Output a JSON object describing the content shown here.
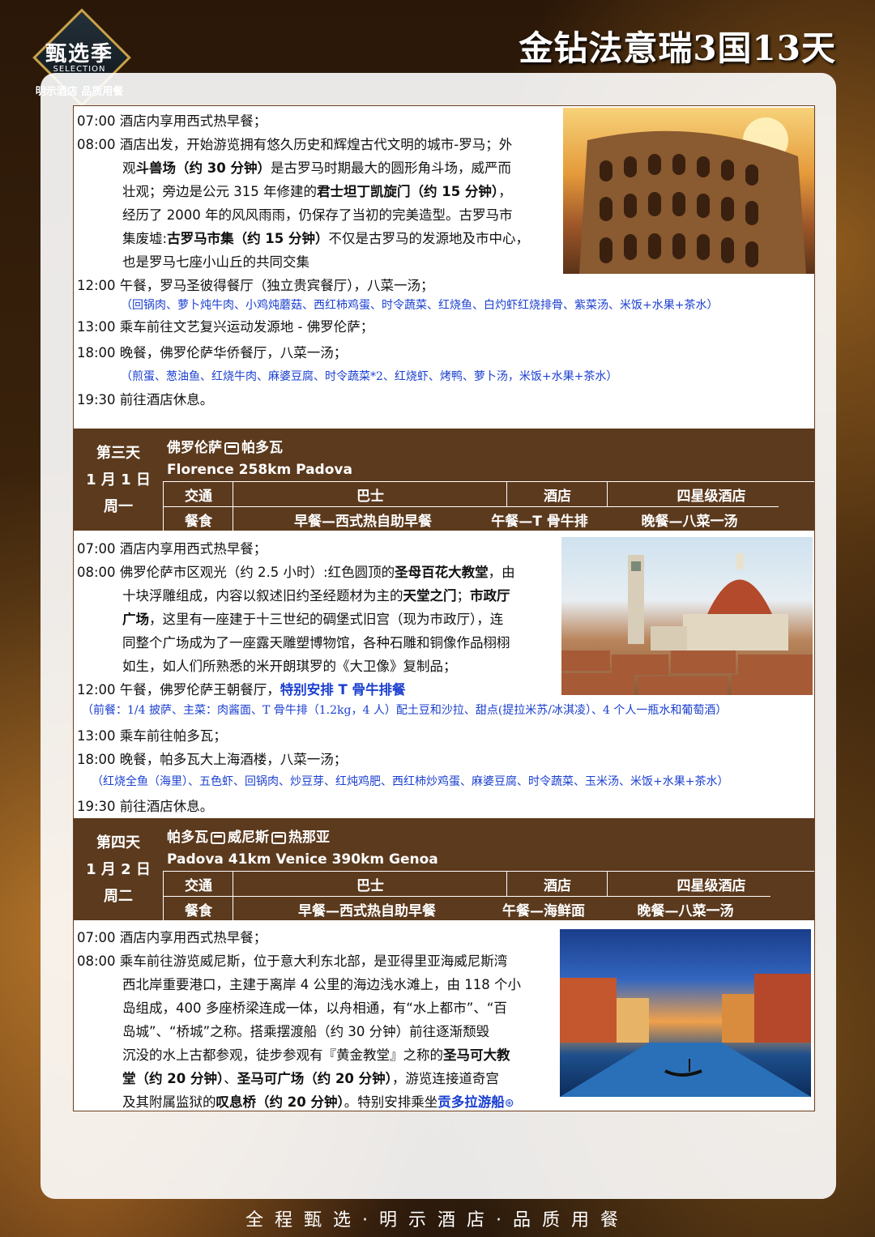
{
  "header": {
    "logo_title": "甄选季",
    "logo_sub": "SELECTION",
    "logo_tag": "明示酒店 品质用餐",
    "tour_title": "金钻法意瑞3国13天"
  },
  "day2_tail": {
    "lines": [
      "07:00 酒店内享用西式热早餐；",
      "08:00 酒店出发，开始游览拥有悠久历史和辉煌古代文明的城市-罗马；外",
      [
        "观",
        {
          "b": "斗兽场（约 30 分钟）"
        },
        "是古罗马时期最大的圆形角斗场，威严而"
      ],
      [
        "壮观；旁边是公元 315 年修建的",
        {
          "b": "君士坦丁凯旋门（约 15 分钟）"
        },
        "，"
      ],
      "经历了 2000 年的风风雨雨，仍保存了当初的完美造型。古罗马市",
      [
        "集废墟:",
        {
          "b": "古罗马市集（约 15 分钟）"
        },
        "不仅是古罗马的发源地及市中心，"
      ],
      "也是罗马七座小山丘的共同交集",
      "12:00 午餐，罗马圣彼得餐厅（独立贵宾餐厅），八菜一汤；",
      "（回锅肉、萝卜炖牛肉、小鸡炖蘑菇、西红柿鸡蛋、时令蔬菜、红烧鱼、白灼虾红烧排骨、紫菜汤、米饭+水果+茶水）",
      "13:00 乘车前往文艺复兴运动发源地 - 佛罗伦萨；",
      "18:00 晚餐，佛罗伦萨华侨餐厅，八菜一汤；",
      "（煎蛋、葱油鱼、红烧牛肉、麻婆豆腐、时令蔬菜*2、红烧虾、烤鸭、萝卜汤，米饭+水果+茶水）",
      "19:30 前往酒店休息。"
    ]
  },
  "day3": {
    "day": "第三天",
    "date": "1 月 1 日",
    "weekday": "周一",
    "route_a": "佛罗伦萨",
    "route_b": "帕多瓦",
    "route_en": "Florence 258km Padova",
    "transport_label": "交通",
    "transport": "巴士",
    "hotel_label": "酒店",
    "hotel": "四星级酒店",
    "meals_label": "餐食",
    "breakfast": "早餐—西式热自助早餐",
    "lunch": "午餐—T 骨牛排",
    "dinner": "晚餐—八菜一汤",
    "lines": [
      "07:00 酒店内享用西式热早餐；",
      [
        "08:00 佛罗伦萨市区观光（约 2.5 小时）:红色圆顶的",
        {
          "b": "圣母百花大教堂"
        },
        "，由"
      ],
      [
        "十块浮雕组成，内容以叙述旧约圣经题材为主的",
        {
          "b": "天堂之门"
        },
        "；",
        {
          "b": "市政厅"
        }
      ],
      [
        {
          "b": "广场"
        },
        "，这里有一座建于十三世纪的碉堡式旧宫（现为市政厅），连"
      ],
      "同整个广场成为了一座露天雕塑博物馆，各种石雕和铜像作品栩栩",
      "如生，如人们所熟悉的米开朗琪罗的《大卫像》复制品；",
      [
        "12:00 午餐，佛罗伦萨王朝餐厅，",
        {
          "blue": "特别安排 T 骨牛排餐"
        }
      ],
      "（前餐：1/4 披萨、主菜：肉酱面、T 骨牛排（1.2kg，4 人）配土豆和沙拉、甜点(提拉米苏/冰淇凌）、4 个人一瓶水和葡萄酒）",
      "13:00 乘车前往帕多瓦；",
      "18:00 晚餐，帕多瓦大上海酒楼，八菜一汤；",
      "（红烧全鱼（海里）、五色虾、回锅肉、炒豆芽、红炖鸡肥、西红柿炒鸡蛋、麻婆豆腐、时令蔬菜、玉米汤、米饭+水果+茶水）",
      "19:30 前往酒店休息。"
    ]
  },
  "day4": {
    "day": "第四天",
    "date": "1 月 2 日",
    "weekday": "周二",
    "route_a": "帕多瓦",
    "route_b": "威尼斯",
    "route_c": "热那亚",
    "route_en": "Padova 41km Venice 390km Genoa",
    "transport_label": "交通",
    "transport": "巴士",
    "hotel_label": "酒店",
    "hotel": "四星级酒店",
    "meals_label": "餐食",
    "breakfast": "早餐—西式热自助早餐",
    "lunch": "午餐—海鲜面",
    "dinner": "晚餐—八菜一汤",
    "lines": [
      "07:00 酒店内享用西式热早餐；",
      "08:00 乘车前往游览威尼斯，位于意大利东北部，是亚得里亚海威尼斯湾",
      "西北岸重要港口，主建于离岸 4 公里的海边浅水滩上，由 118 个小",
      "岛组成，400 多座桥梁连成一体，以舟相通，有“水上都市”、“百",
      "岛城”、“桥城”之称。搭乘摆渡船（约 30 分钟）前往逐渐颓毁",
      [
        "沉没的水上古都参观，徒步参观有『黄金教堂』之称的",
        {
          "b": "圣马可大教"
        }
      ],
      [
        {
          "b": "堂（约 20 分钟）"
        },
        "、",
        {
          "b": "圣马可广场（约 20 分钟）"
        },
        "，游览连接道奇宫"
      ],
      [
        "及其附属监狱的",
        {
          "b": "叹息桥（约 20 分钟）"
        },
        "。特别安排乘坐",
        {
          "blue": "贡多拉游船"
        }
      ]
    ]
  },
  "footer": {
    "slogan": "全程甄选·明示酒店·品质用餐"
  }
}
